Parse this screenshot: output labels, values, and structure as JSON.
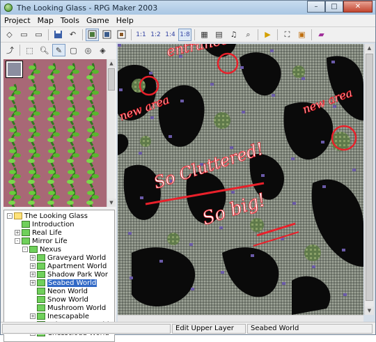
{
  "window": {
    "title": "The Looking Glass - RPG Maker 2003",
    "minimize": "–",
    "maximize": "□",
    "close": "✕"
  },
  "menu": [
    "Project",
    "Map",
    "Tools",
    "Game",
    "Help"
  ],
  "toolbar": {
    "layer_icons": [
      "1:1",
      "1:2",
      "1:4",
      "1:8"
    ]
  },
  "tree": [
    {
      "label": "The Looking Glass",
      "depth": 0,
      "exp": "-",
      "folder": true
    },
    {
      "label": "Introduction",
      "depth": 1,
      "exp": ""
    },
    {
      "label": "Real Life",
      "depth": 1,
      "exp": "+"
    },
    {
      "label": "Mirror Life",
      "depth": 1,
      "exp": "-"
    },
    {
      "label": "Nexus",
      "depth": 2,
      "exp": "-"
    },
    {
      "label": "Graveyard World",
      "depth": 3,
      "exp": "+"
    },
    {
      "label": "Apartment World",
      "depth": 3,
      "exp": "+"
    },
    {
      "label": "Shadow Park Wor",
      "depth": 3,
      "exp": "+"
    },
    {
      "label": "Seabed World",
      "depth": 3,
      "exp": "+",
      "selected": true
    },
    {
      "label": "Neon World",
      "depth": 3,
      "exp": ""
    },
    {
      "label": "Snow World",
      "depth": 3,
      "exp": ""
    },
    {
      "label": "Mushroom World",
      "depth": 3,
      "exp": ""
    },
    {
      "label": "Inescapable",
      "depth": 3,
      "exp": "+"
    },
    {
      "label": "Pokeymans World",
      "depth": 3,
      "exp": "+"
    },
    {
      "label": "Chesscloud World",
      "depth": 3,
      "exp": "+"
    }
  ],
  "annotations": {
    "entrance": "entrance",
    "new_area_left": "new area",
    "new_area_right": "new area",
    "cluttered": "So Cluttered!",
    "big": "So big!"
  },
  "status": {
    "left": "",
    "mode": "Edit Upper Layer",
    "map": "Seabed World"
  },
  "colors": {
    "annotation": "#e8202a",
    "map_ground": "#8a8f86",
    "map_void": "#0a0a0a"
  }
}
